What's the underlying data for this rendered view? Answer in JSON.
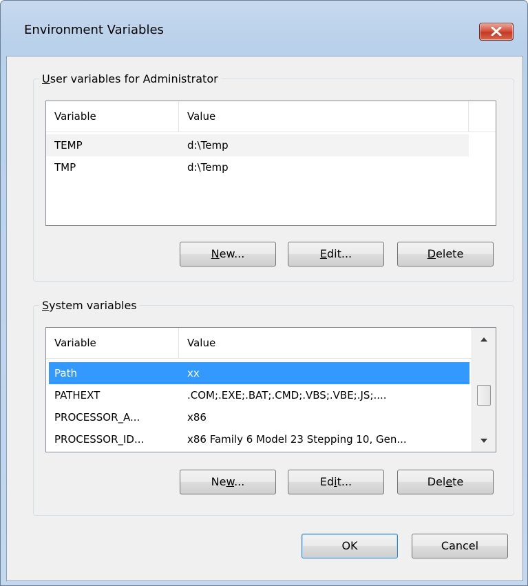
{
  "window": {
    "title": "Environment Variables"
  },
  "user_group": {
    "legend_pre": "",
    "legend_accel": "U",
    "legend_post": "ser variables for Administrator",
    "columns": [
      "Variable",
      "Value"
    ],
    "rows": [
      {
        "variable": "TEMP",
        "value": "d:\\Temp"
      },
      {
        "variable": "TMP",
        "value": "d:\\Temp"
      }
    ],
    "buttons": {
      "new": {
        "pre": "",
        "accel": "N",
        "post": "ew..."
      },
      "edit": {
        "pre": "",
        "accel": "E",
        "post": "dit..."
      },
      "delete": {
        "pre": "",
        "accel": "D",
        "post": "elete"
      }
    }
  },
  "system_group": {
    "legend_pre": "",
    "legend_accel": "S",
    "legend_post": "ystem variables",
    "columns": [
      "Variable",
      "Value"
    ],
    "rows": [
      {
        "variable": "Path",
        "value": "xx"
      },
      {
        "variable": "PATHEXT",
        "value": ".COM;.EXE;.BAT;.CMD;.VBS;.VBE;.JS;...."
      },
      {
        "variable": "PROCESSOR_A...",
        "value": "x86"
      },
      {
        "variable": "PROCESSOR_ID...",
        "value": "x86 Family 6 Model 23 Stepping 10, Gen..."
      }
    ],
    "selected_row": "Path",
    "buttons": {
      "new": {
        "pre": "Ne",
        "accel": "w",
        "post": "..."
      },
      "edit": {
        "pre": "Ed",
        "accel": "i",
        "post": "t..."
      },
      "delete": {
        "pre": "Del",
        "accel": "e",
        "post": "te"
      }
    }
  },
  "footer": {
    "ok": "OK",
    "cancel": "Cancel"
  },
  "icons": {
    "close": "close-icon",
    "scroll_up": "scroll-up-arrow-icon",
    "scroll_down": "scroll-down-arrow-icon"
  },
  "colors": {
    "selection": "#3399ff",
    "close_button": "#d6533e"
  }
}
